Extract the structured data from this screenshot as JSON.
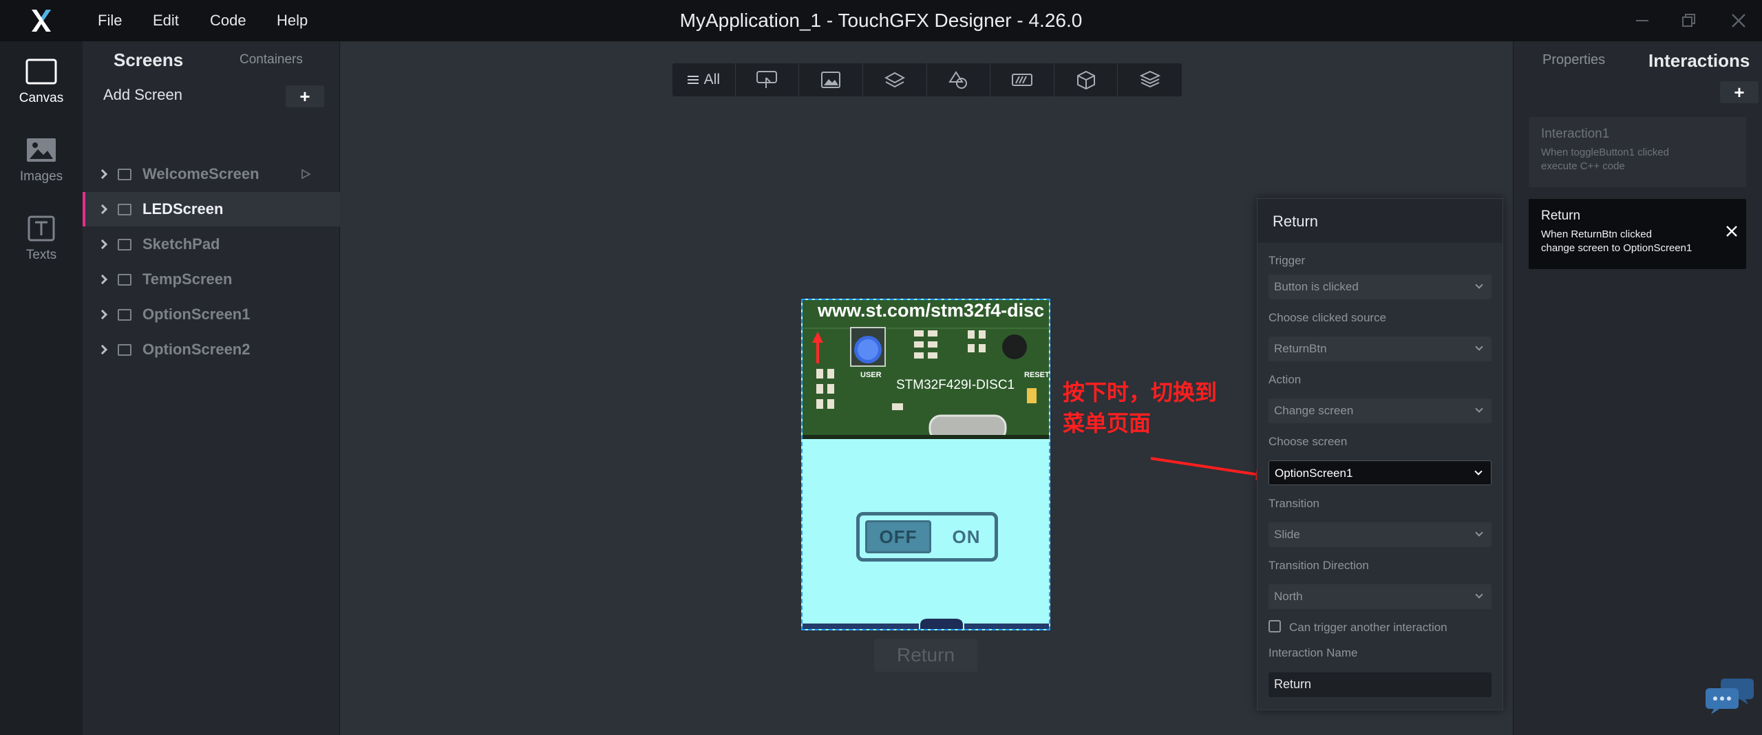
{
  "titlebar": {
    "app_title": "MyApplication_1 - TouchGFX Designer - 4.26.0",
    "menu": [
      "File",
      "Edit",
      "Code",
      "Help"
    ],
    "logo_icon": "touchgfx-x-logo"
  },
  "rail": {
    "items": [
      {
        "label": "Canvas",
        "icon": "canvas-icon",
        "active": true
      },
      {
        "label": "Images",
        "icon": "image-icon",
        "active": false
      },
      {
        "label": "Texts",
        "icon": "text-icon",
        "active": false
      }
    ]
  },
  "screens_panel": {
    "tabs": [
      "Screens",
      "Containers"
    ],
    "add_screen_label": "Add Screen",
    "add_symbol": "+",
    "screens": [
      {
        "name": "WelcomeScreen",
        "start": true
      },
      {
        "name": "LEDScreen",
        "selected": true
      },
      {
        "name": "SketchPad"
      },
      {
        "name": "TempScreen"
      },
      {
        "name": "OptionScreen1"
      },
      {
        "name": "OptionScreen2"
      }
    ]
  },
  "canvas": {
    "filter_all_label": "All",
    "filter_icons": [
      "interactive-widget-icon",
      "image-widget-icon",
      "layers-icon",
      "shapes-icon",
      "progress-icon",
      "3d-cube-icon",
      "stack-icon"
    ],
    "board": {
      "url_text": "www.st.com/stm32f4-disc",
      "model_text": "STM32F429I-DISC1",
      "user_text": "USER",
      "reset_text": "RESET"
    },
    "toggle": {
      "off_label": "OFF",
      "on_label": "ON"
    },
    "return_button_label": "Return",
    "annotation_lines": [
      "按下时，切换到",
      "菜单页面"
    ]
  },
  "editor": {
    "title": "Return",
    "fields": [
      {
        "label": "Trigger",
        "value": "Button is clicked"
      },
      {
        "label": "Choose clicked source",
        "value": "ReturnBtn"
      },
      {
        "label": "Action",
        "value": "Change screen"
      },
      {
        "label": "Choose screen",
        "value": "OptionScreen1",
        "active": true
      },
      {
        "label": "Transition",
        "value": "Slide"
      },
      {
        "label": "Transition Direction",
        "value": "North"
      }
    ],
    "checkbox_label": "Can trigger another interaction",
    "interaction_name_label": "Interaction Name",
    "interaction_name_value": "Return"
  },
  "right_panel": {
    "tabs": [
      "Properties",
      "Interactions"
    ],
    "add_symbol": "+",
    "interactions": [
      {
        "title": "Interaction1",
        "lines": [
          "When toggleButton1 clicked",
          "execute C++ code"
        ]
      },
      {
        "title": "Return",
        "lines": [
          "When ReturnBtn clicked",
          "change screen to OptionScreen1"
        ],
        "selected": true
      }
    ]
  },
  "colors": {
    "accent_pink": "#e0318f",
    "selection_blue": "#1aa0ff",
    "device_background": "#a8fbfb",
    "annotation_red": "#ff1f1f"
  }
}
